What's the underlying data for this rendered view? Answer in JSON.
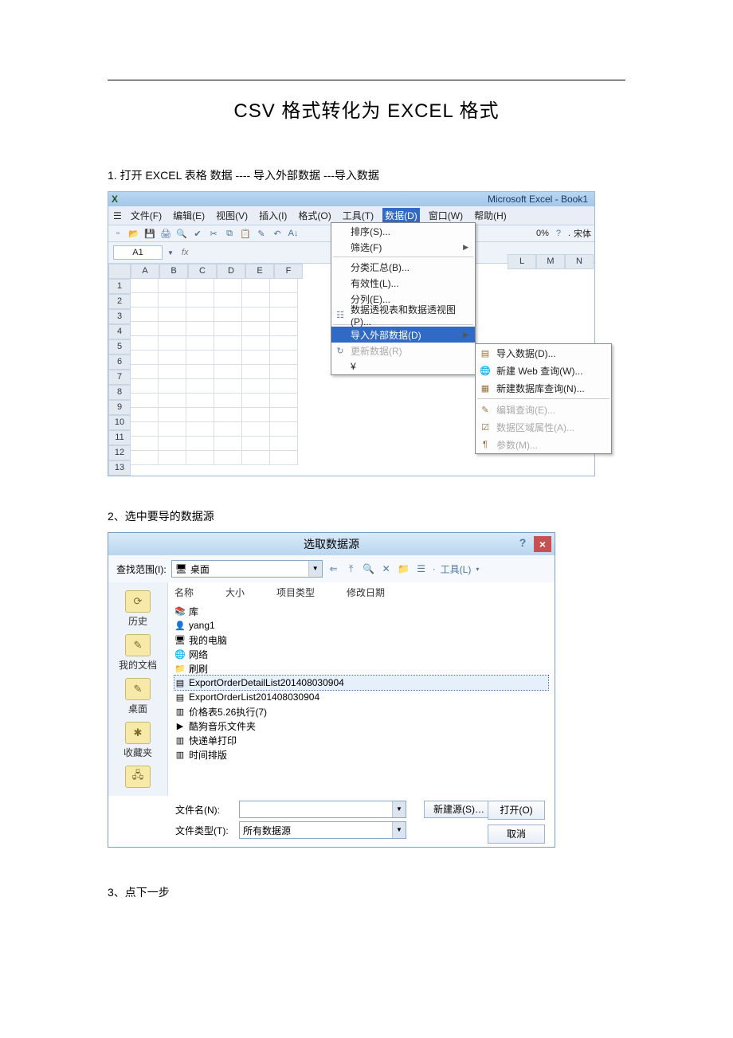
{
  "doc": {
    "title": "CSV 格式转化为  EXCEL 格式",
    "step1": "1.   打开 EXCEL  表格        数据  ----  导入外部数据 ---导入数据",
    "step2": "2、选中要导的数据源",
    "step3": "3、点下一步"
  },
  "excel": {
    "brand": "Microsoft Excel - Book1",
    "menus": [
      "文件(F)",
      "编辑(E)",
      "视图(V)",
      "插入(I)",
      "格式(O)",
      "工具(T)",
      "数据(D)",
      "窗口(W)",
      "帮助(H)"
    ],
    "selected_menu_index": 6,
    "namebox": "A1",
    "fx": "fx",
    "zoom": "0%",
    "font": "宋体",
    "columns": [
      "A",
      "B",
      "C",
      "D",
      "E",
      "F"
    ],
    "columns_right": [
      "L",
      "M",
      "N"
    ],
    "rows": [
      "1",
      "2",
      "3",
      "4",
      "5",
      "6",
      "7",
      "8",
      "9",
      "10",
      "11",
      "12",
      "13"
    ],
    "data_menu": {
      "items": [
        {
          "label": "排序(S)..."
        },
        {
          "label": "筛选(F)",
          "submenu": true
        },
        {
          "label": "分类汇总(B)..."
        },
        {
          "label": "有效性(L)..."
        },
        {
          "label": "分列(E)..."
        },
        {
          "label": "数据透视表和数据透视图(P)...",
          "icon": "☷"
        },
        {
          "label": "导入外部数据(D)",
          "submenu": true,
          "selected": true
        },
        {
          "label": "更新数据(R)",
          "icon": "↻",
          "disabled": true
        },
        {
          "label": "¥"
        }
      ]
    },
    "import_submenu": [
      {
        "label": "导入数据(D)...",
        "icon": "▤"
      },
      {
        "label": "新建 Web 查询(W)...",
        "icon": "🌐"
      },
      {
        "label": "新建数据库查询(N)...",
        "icon": "▦"
      },
      {
        "label": "编辑查询(E)...",
        "icon": "✎",
        "disabled": true
      },
      {
        "label": "数据区域属性(A)...",
        "icon": "☑",
        "disabled": true
      },
      {
        "label": "参数(M)...",
        "icon": "¶",
        "disabled": true
      }
    ]
  },
  "dialog": {
    "title": "选取数据源",
    "lookin_label": "查找范围(I):",
    "lookin_value": "桌面",
    "toolbar_tools_label": "工具(L)",
    "headers": [
      "名称",
      "大小",
      "项目类型",
      "修改日期"
    ],
    "places": [
      {
        "label": "历史",
        "icon": "⟳"
      },
      {
        "label": "我的文档",
        "icon": "✎"
      },
      {
        "label": "桌面",
        "icon": "✎"
      },
      {
        "label": "收藏夹",
        "icon": "✱"
      }
    ],
    "netplace": "?",
    "files": [
      {
        "label": "库",
        "icon": "📚"
      },
      {
        "label": "yang1",
        "icon": "👤"
      },
      {
        "label": "我的电脑",
        "icon": "🖥"
      },
      {
        "label": "网络",
        "icon": "🌐"
      },
      {
        "label": "刷刷",
        "icon": "📁"
      },
      {
        "label": "ExportOrderDetailList201408030904",
        "icon": "▤",
        "selected": true
      },
      {
        "label": "ExportOrderList201408030904",
        "icon": "▤"
      },
      {
        "label": "价格表5.26执行(7)",
        "icon": "▥"
      },
      {
        "label": "酷狗音乐文件夹",
        "icon": "▶"
      },
      {
        "label": "快递单打印",
        "icon": "▥"
      },
      {
        "label": "时间排版",
        "icon": "▥"
      }
    ],
    "filename_label": "文件名(N):",
    "filename_value": "",
    "filetype_label": "文件类型(T):",
    "filetype_value": "所有数据源",
    "newsource_btn": "新建源(S)…",
    "open_btn": "打开(O)",
    "cancel_btn": "取消"
  }
}
